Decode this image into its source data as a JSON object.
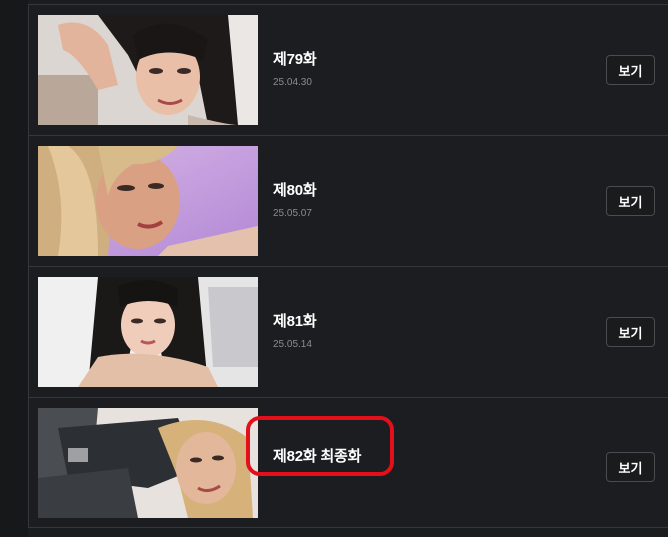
{
  "episodes": [
    {
      "title": "제79화",
      "date": "25.04.30",
      "button_label": "보기",
      "thumbnail_icon": "episode-79-thumbnail"
    },
    {
      "title": "제80화",
      "date": "25.05.07",
      "button_label": "보기",
      "thumbnail_icon": "episode-80-thumbnail"
    },
    {
      "title": "제81화",
      "date": "25.05.14",
      "button_label": "보기",
      "thumbnail_icon": "episode-81-thumbnail"
    },
    {
      "title": "제82화 최종화",
      "date": "",
      "button_label": "보기",
      "thumbnail_icon": "episode-82-thumbnail"
    }
  ],
  "colors": {
    "background": "#1b1c1e",
    "divider": "#35373a",
    "highlight": "#e3101b",
    "date_text": "#8a8c90"
  }
}
